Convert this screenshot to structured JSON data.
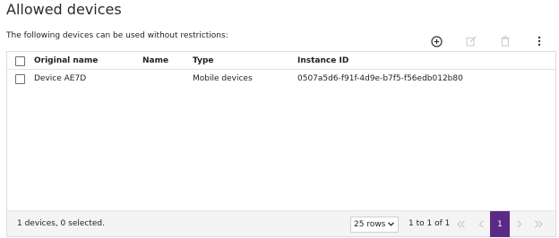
{
  "header": {
    "title": "Allowed devices",
    "description": "The following devices can be used without restrictions:"
  },
  "toolbar": {
    "add_icon": "add-circle-icon",
    "edit_icon": "edit-icon",
    "delete_icon": "trash-icon",
    "more_icon": "more-vertical-icon"
  },
  "table": {
    "columns": [
      "Original name",
      "Name",
      "Type",
      "Instance ID"
    ],
    "rows": [
      {
        "original_name": "Device AE7D",
        "name": "",
        "type": "Mobile devices",
        "instance_id": "0507a5d6-f91f-4d9e-b7f5-f56edb012b80"
      }
    ]
  },
  "footer": {
    "status": "1 devices, 0 selected.",
    "rows_per_page": "25 rows",
    "range": "1 to 1 of 1",
    "current_page": "1"
  },
  "colors": {
    "accent": "#5b2a86",
    "disabled": "#c9c9c9"
  }
}
